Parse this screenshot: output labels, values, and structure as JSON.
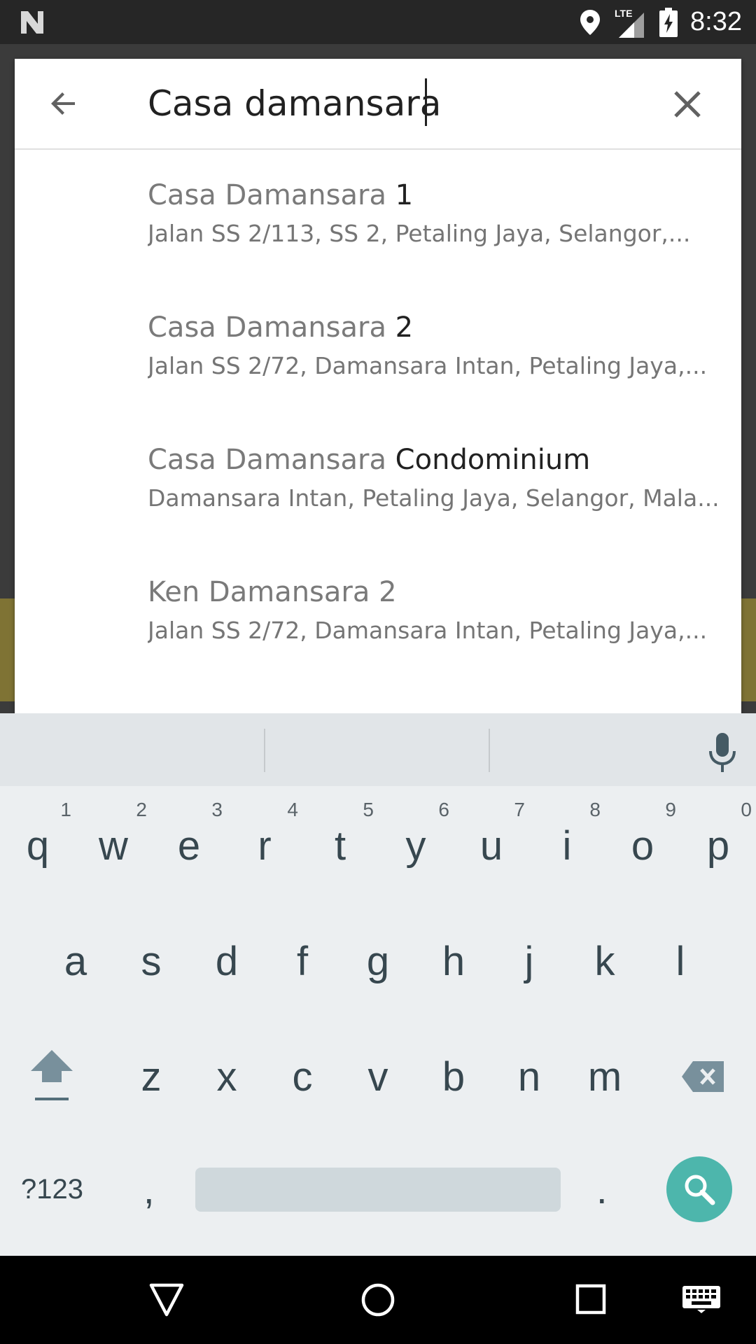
{
  "status_bar": {
    "time": "8:32",
    "network": "LTE"
  },
  "search": {
    "query": "Casa damansara"
  },
  "suggestions": [
    {
      "title_match": "Casa Damansara",
      "title_rest": " 1",
      "subtitle": "Jalan SS 2/113, SS 2, Petaling Jaya, Selangor,..."
    },
    {
      "title_match": "Casa Damansara",
      "title_rest": " 2",
      "subtitle": "Jalan SS 2/72, Damansara Intan, Petaling Jaya,..."
    },
    {
      "title_match": "Casa Damansara",
      "title_rest": " Condominium",
      "subtitle": "Damansara Intan, Petaling Jaya, Selangor, Mala..."
    },
    {
      "title_match": "Ken Damansara 2",
      "title_rest": "",
      "subtitle": "Jalan SS 2/72, Damansara Intan, Petaling Jaya,..."
    }
  ],
  "keyboard": {
    "row1": [
      {
        "k": "q",
        "n": "1"
      },
      {
        "k": "w",
        "n": "2"
      },
      {
        "k": "e",
        "n": "3"
      },
      {
        "k": "r",
        "n": "4"
      },
      {
        "k": "t",
        "n": "5"
      },
      {
        "k": "y",
        "n": "6"
      },
      {
        "k": "u",
        "n": "7"
      },
      {
        "k": "i",
        "n": "8"
      },
      {
        "k": "o",
        "n": "9"
      },
      {
        "k": "p",
        "n": "0"
      }
    ],
    "row2": [
      "a",
      "s",
      "d",
      "f",
      "g",
      "h",
      "j",
      "k",
      "l"
    ],
    "row3": [
      "z",
      "x",
      "c",
      "v",
      "b",
      "n",
      "m"
    ],
    "symbols_label": "?123",
    "comma": ",",
    "period": "."
  },
  "colors": {
    "accent": "#4db6ac",
    "olive_banner": "#7f7334"
  }
}
